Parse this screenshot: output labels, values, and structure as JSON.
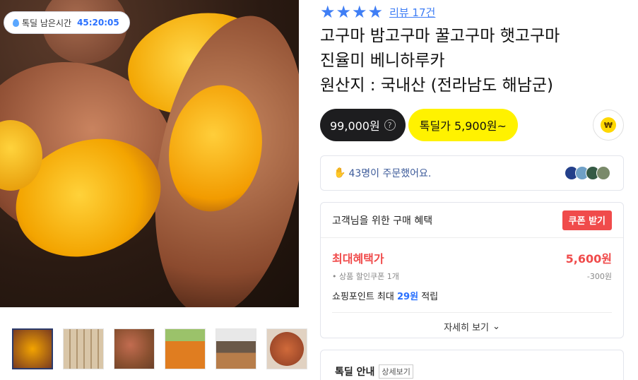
{
  "timer": {
    "label": "톡딜 남은시간",
    "value": "45:20:05"
  },
  "rating": {
    "stars": 4,
    "review_link": "리뷰 17건"
  },
  "product": {
    "title_lines": [
      "고구마 밤고구마 꿀고구마 햇고구마",
      "진율미 베니하루카",
      "원산지 : 국내산 (전라남도 해남군)"
    ]
  },
  "price": {
    "regular": "99,000원",
    "deal": "톡딜가 5,900원~",
    "help_glyph": "?",
    "coin_glyph": "₩"
  },
  "orders": {
    "text": "43명이 주문했어요."
  },
  "benefit": {
    "title": "고객님을 위한 구매 혜택",
    "coupon_button": "쿠폰 받기",
    "max_label": "최대혜택가",
    "max_value": "5,600원",
    "coupon_item": "상품 할인쿠폰 1개",
    "coupon_amount": "-300원",
    "points_prefix": "쇼핑포인트 최대",
    "points_value": "29원",
    "points_suffix": "적립",
    "detail_link": "자세히 보기"
  },
  "deal_info": {
    "title": "톡딜 안내",
    "detail_link": "상세보기"
  },
  "thumbnails": 6,
  "colors": {
    "accent_blue": "#3f7ef5",
    "deal_yellow": "#fff200",
    "red": "#f04b4b",
    "dark": "#1d1d1f"
  }
}
